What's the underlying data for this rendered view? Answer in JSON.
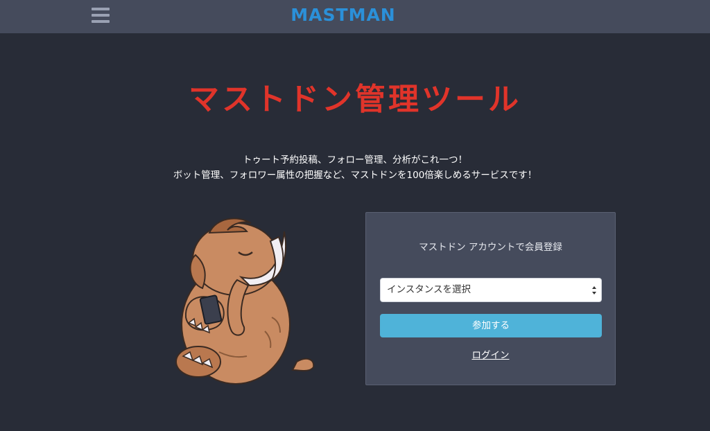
{
  "header": {
    "brand": "MASTMAN",
    "menu_icon": "hamburger-menu-icon"
  },
  "hero": {
    "title": "マストドン管理ツール",
    "lead_line1": "トゥート予約投稿、フォロー管理、分析がこれ一つ！",
    "lead_line2": "ボット管理、フォロワー属性の把握など、マストドンを100倍楽しめるサービスです！"
  },
  "signup": {
    "title": "マストドン アカウントで会員登録",
    "instance_select": {
      "selected": "インスタンスを選択",
      "icon": "select-arrows-icon"
    },
    "join_label": "参加する",
    "login_label": "ログイン"
  },
  "mascot": {
    "icon": "mastodon-mascot-illustration"
  },
  "colors": {
    "background": "#282c37",
    "topbar": "#454b5c",
    "brand": "#2b90d9",
    "title": "#e0342a",
    "button": "#4fb3d9"
  }
}
